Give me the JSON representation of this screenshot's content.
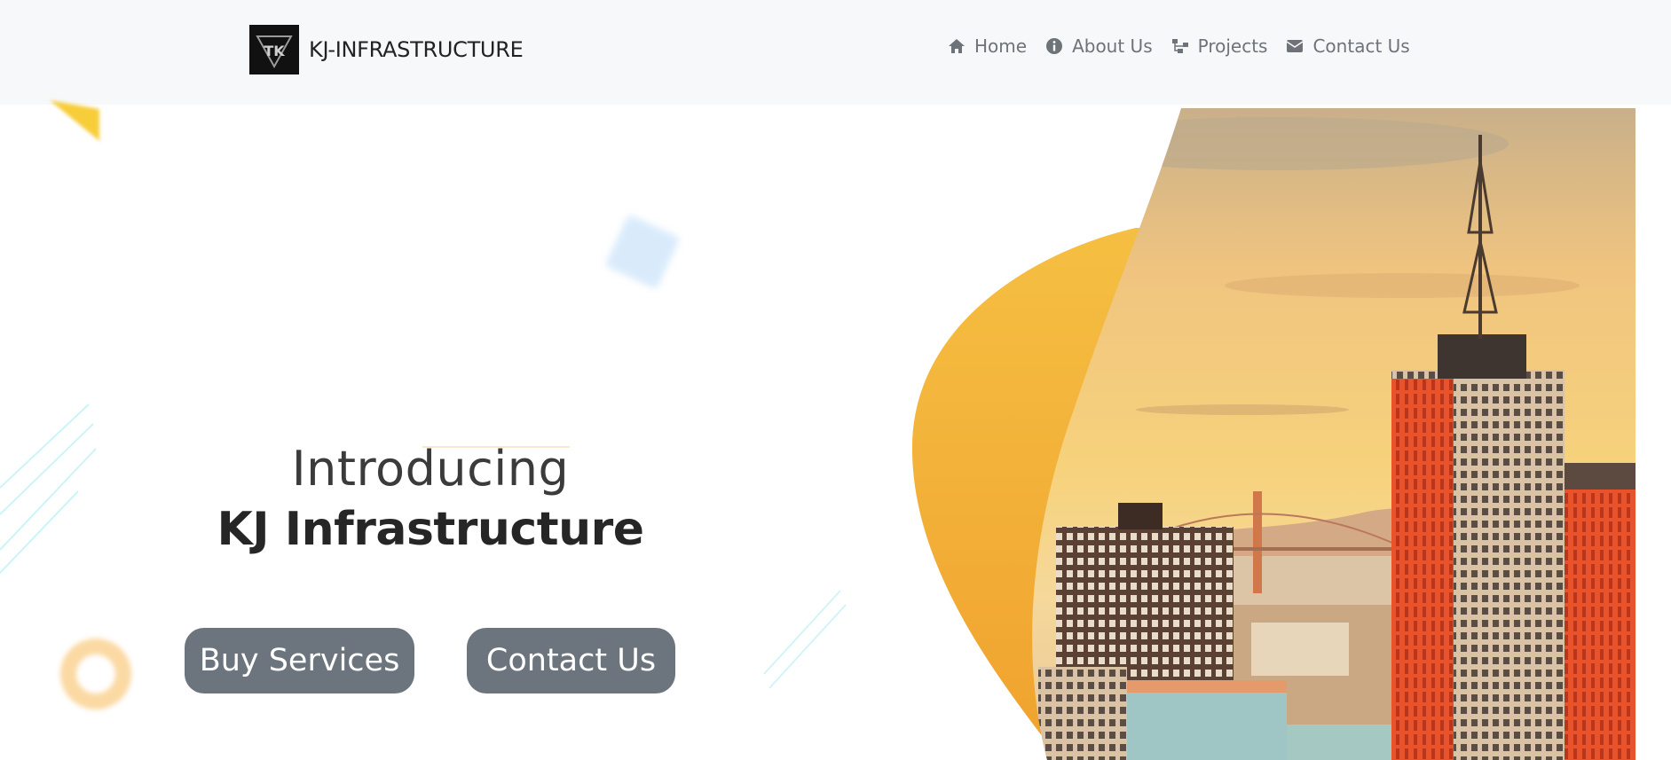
{
  "brand": {
    "name": "KJ-INFRASTRUCTURE",
    "logo_icon": "kj-logo-icon"
  },
  "nav": {
    "items": [
      {
        "label": "Home",
        "icon": "home-icon"
      },
      {
        "label": "About Us",
        "icon": "info-icon"
      },
      {
        "label": "Projects",
        "icon": "sitemap-icon"
      },
      {
        "label": "Contact Us",
        "icon": "envelope-icon"
      }
    ]
  },
  "hero": {
    "intro": "Introducing",
    "title": "KJ Infrastructure",
    "buttons": {
      "buy": "Buy Services",
      "contact": "Contact Us"
    }
  },
  "colors": {
    "accent": "#f2b233",
    "button": "#6c757d",
    "nav_text": "#6d7378",
    "header_bg": "#f7f8fa"
  }
}
